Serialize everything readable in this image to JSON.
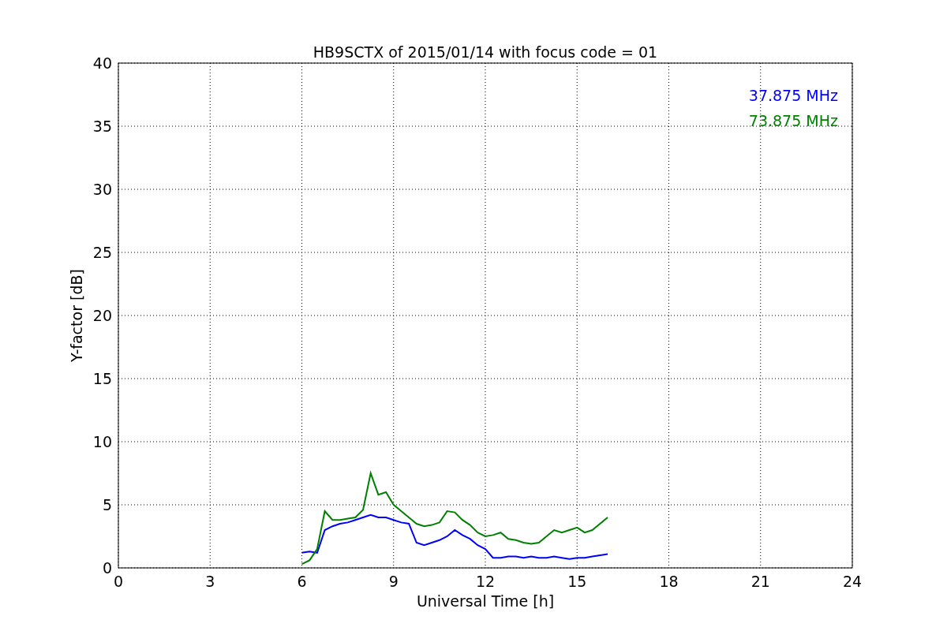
{
  "chart_data": {
    "type": "line",
    "title": "HB9SCTX of 2015/01/14 with focus code = 01",
    "xlabel": "Universal Time [h]",
    "ylabel": "Y-factor [dB]",
    "x": [
      6,
      6.25,
      6.5,
      6.75,
      7,
      7.25,
      7.5,
      7.75,
      8,
      8.25,
      8.5,
      8.75,
      9,
      9.25,
      9.5,
      9.75,
      10,
      10.25,
      10.5,
      10.75,
      11,
      11.25,
      11.5,
      11.75,
      12,
      12.25,
      12.5,
      12.75,
      13,
      13.25,
      13.5,
      13.75,
      14,
      14.25,
      14.5,
      14.75,
      15,
      15.25,
      15.5,
      15.75,
      16
    ],
    "series": [
      {
        "name": "37.875 MHz",
        "color": "#0000ff",
        "values": [
          1.2,
          1.3,
          1.2,
          3.0,
          3.3,
          3.5,
          3.6,
          3.8,
          4.0,
          4.2,
          4.0,
          4.0,
          3.8,
          3.6,
          3.5,
          2.0,
          1.8,
          2.0,
          2.2,
          2.5,
          3.0,
          2.6,
          2.3,
          1.8,
          1.5,
          0.8,
          0.8,
          0.9,
          0.9,
          0.8,
          0.9,
          0.8,
          0.8,
          0.9,
          0.8,
          0.7,
          0.8,
          0.8,
          0.9,
          1.0,
          1.1
        ]
      },
      {
        "name": "73.875 MHz",
        "color": "#008000",
        "values": [
          0.3,
          0.6,
          1.5,
          4.5,
          3.8,
          3.8,
          3.9,
          4.0,
          4.6,
          7.5,
          5.8,
          6.0,
          5.0,
          4.5,
          4.0,
          3.5,
          3.3,
          3.4,
          3.6,
          4.5,
          4.4,
          3.8,
          3.4,
          2.8,
          2.5,
          2.6,
          2.8,
          2.3,
          2.2,
          2.0,
          1.9,
          2.0,
          2.5,
          3.0,
          2.8,
          3.0,
          3.2,
          2.8,
          3.0,
          3.5,
          4.0
        ]
      }
    ],
    "xlim": [
      0,
      24
    ],
    "ylim": [
      0,
      40
    ],
    "xticks": [
      0,
      3,
      6,
      9,
      12,
      15,
      18,
      21,
      24
    ],
    "yticks": [
      0,
      5,
      10,
      15,
      20,
      25,
      30,
      35,
      40
    ],
    "grid": true
  }
}
